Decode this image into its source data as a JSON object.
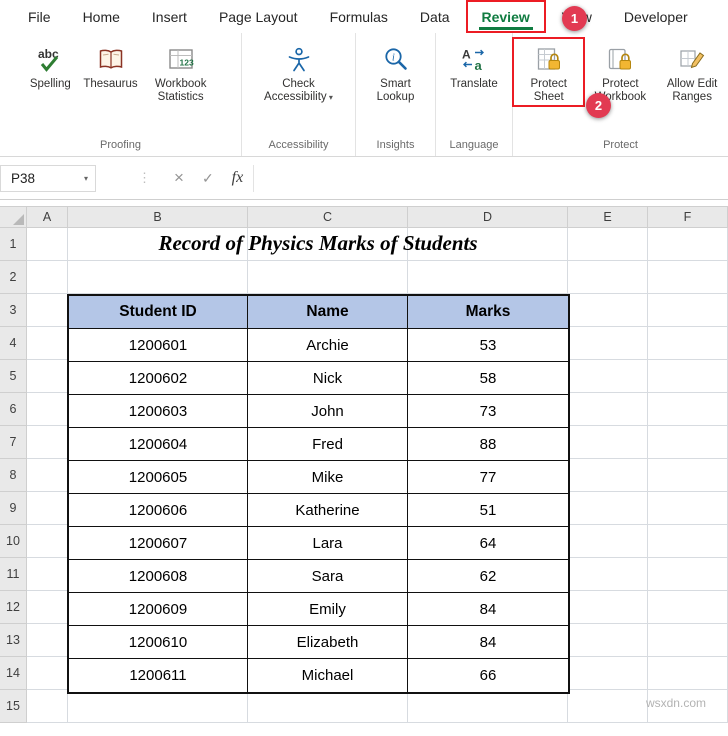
{
  "menu": {
    "tabs": [
      {
        "label": "File",
        "active": false
      },
      {
        "label": "Home",
        "active": false
      },
      {
        "label": "Insert",
        "active": false
      },
      {
        "label": "Page Layout",
        "active": false
      },
      {
        "label": "Formulas",
        "active": false
      },
      {
        "label": "Data",
        "active": false
      },
      {
        "label": "Review",
        "active": true
      },
      {
        "label": "View",
        "active": false
      },
      {
        "label": "Developer",
        "active": false
      }
    ]
  },
  "annotations": {
    "step1": "1",
    "step2": "2"
  },
  "ribbon": {
    "groups": [
      {
        "label": "Proofing",
        "buttons": [
          {
            "id": "spelling",
            "label": "Spelling",
            "icon": "spellcheck-icon"
          },
          {
            "id": "thesaurus",
            "label": "Thesaurus",
            "icon": "thesaurus-book-icon"
          },
          {
            "id": "workbook-statistics",
            "label": "Workbook Statistics",
            "icon": "workbook-statistics-icon"
          }
        ]
      },
      {
        "label": "Accessibility",
        "buttons": [
          {
            "id": "check-accessibility",
            "label": "Check Accessibility",
            "icon": "accessibility-person-icon",
            "dropdown": true
          }
        ]
      },
      {
        "label": "Insights",
        "buttons": [
          {
            "id": "smart-lookup",
            "label": "Smart Lookup",
            "icon": "smart-lookup-icon"
          }
        ]
      },
      {
        "label": "Language",
        "buttons": [
          {
            "id": "translate",
            "label": "Translate",
            "icon": "translate-icon"
          }
        ]
      },
      {
        "label": "Protect",
        "buttons": [
          {
            "id": "protect-sheet",
            "label": "Protect Sheet",
            "icon": "protect-sheet-icon",
            "annotated": true
          },
          {
            "id": "protect-workbook",
            "label": "Protect Workbook",
            "icon": "protect-workbook-icon"
          },
          {
            "id": "allow-edit-ranges",
            "label": "Allow Edit Ranges",
            "icon": "allow-edit-ranges-icon"
          }
        ]
      }
    ]
  },
  "formula_bar": {
    "name_box": "P38",
    "cancel": "×",
    "enter": "✓",
    "fx": "fx",
    "value": ""
  },
  "sheet": {
    "title": "Record of Physics Marks of Students",
    "col_headers": [
      "A",
      "B",
      "C",
      "D",
      "E",
      "F"
    ],
    "row_headers": [
      "1",
      "2",
      "3",
      "4",
      "5",
      "6",
      "7",
      "8",
      "9",
      "10",
      "11",
      "12",
      "13",
      "14",
      "15"
    ],
    "table": {
      "headers": [
        "Student ID",
        "Name",
        "Marks"
      ],
      "rows": [
        [
          "1200601",
          "Archie",
          "53"
        ],
        [
          "1200602",
          "Nick",
          "58"
        ],
        [
          "1200603",
          "John",
          "73"
        ],
        [
          "1200604",
          "Fred",
          "88"
        ],
        [
          "1200605",
          "Mike",
          "77"
        ],
        [
          "1200606",
          "Katherine",
          "51"
        ],
        [
          "1200607",
          "Lara",
          "64"
        ],
        [
          "1200608",
          "Sara",
          "62"
        ],
        [
          "1200609",
          "Emily",
          "84"
        ],
        [
          "1200610",
          "Elizabeth",
          "84"
        ],
        [
          "1200611",
          "Michael",
          "66"
        ]
      ]
    }
  },
  "watermark": "wsxdn.com",
  "colors": {
    "excel_green": "#107C41",
    "annotation_red": "#EC1C24",
    "badge_red": "#E23A52",
    "table_header_fill": "#B4C6E7"
  }
}
